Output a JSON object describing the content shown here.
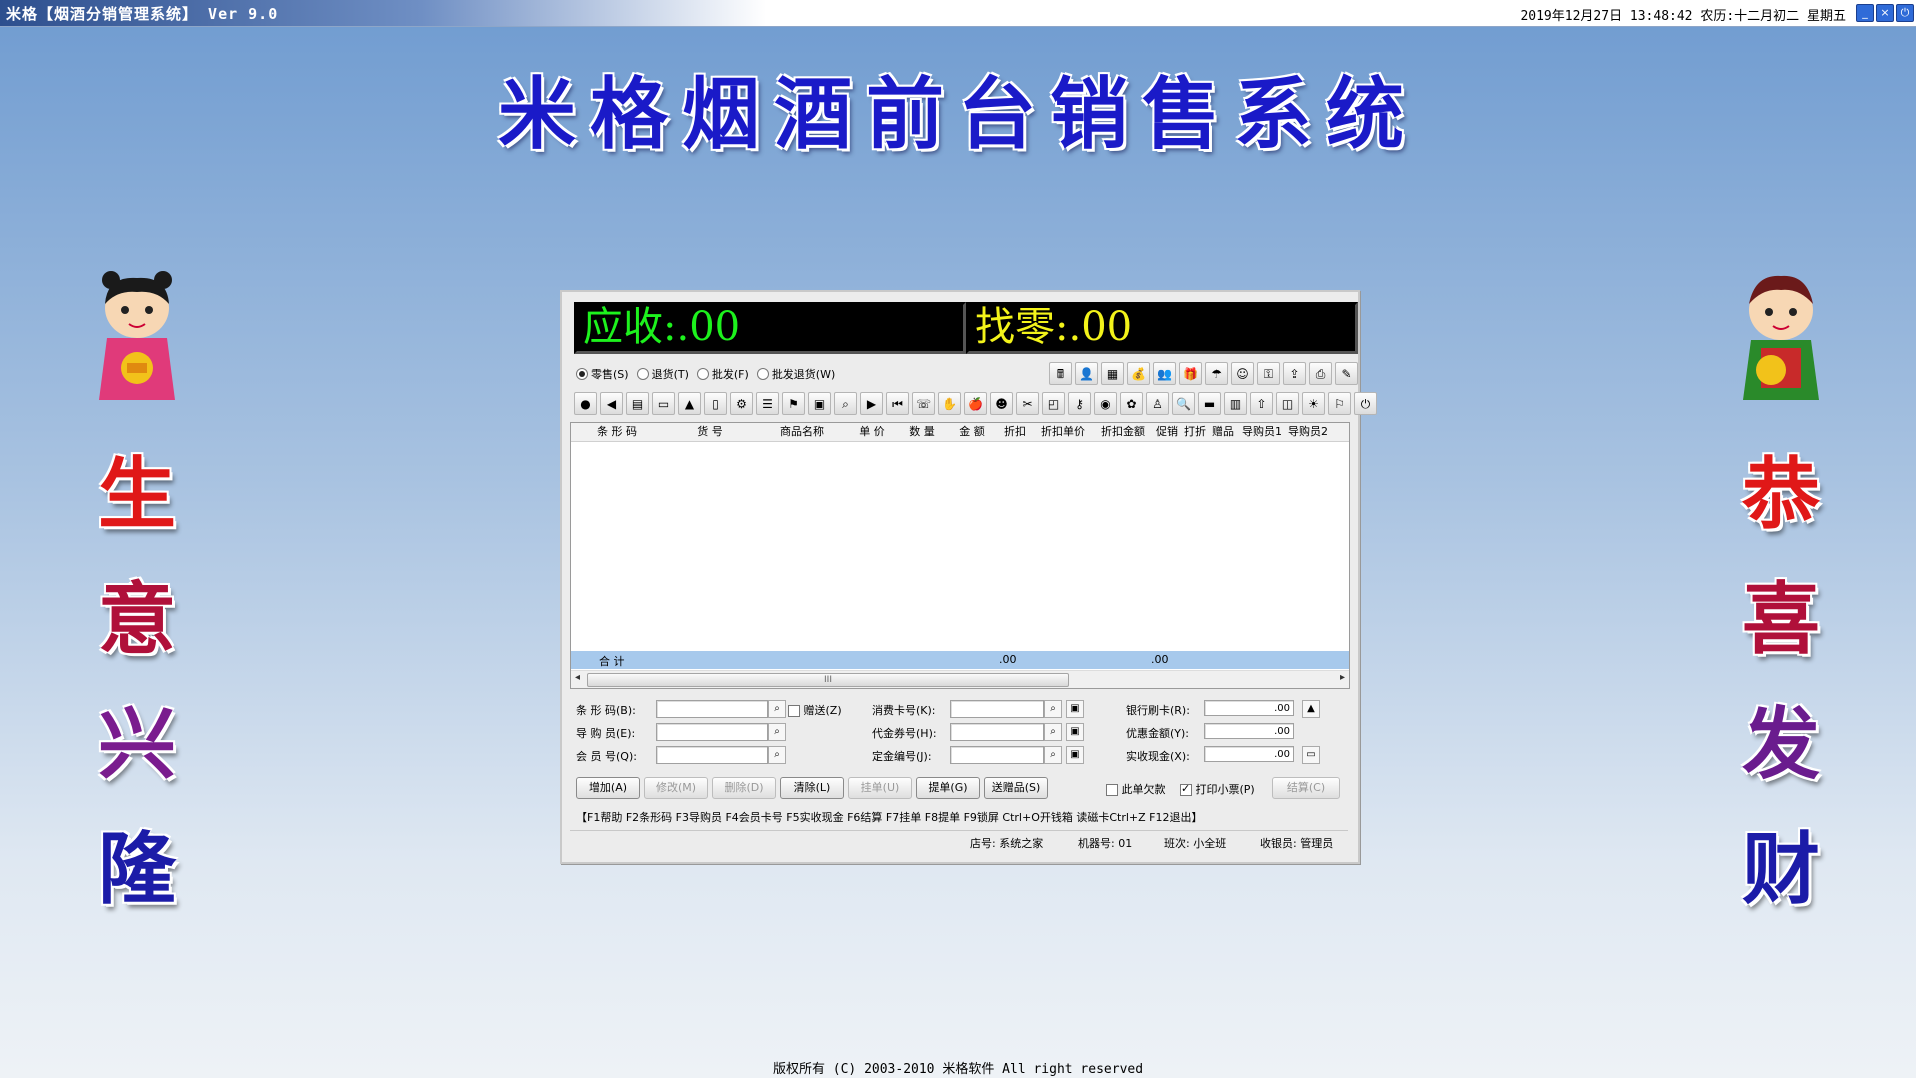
{
  "window": {
    "title": "米格【烟酒分销管理系统】 Ver 9.0",
    "datetime": "2019年12月27日 13:48:42 农历:十二月初二 星期五"
  },
  "banner": {
    "title": "米格烟酒前台销售系统"
  },
  "left_slogan": [
    "生",
    "意",
    "兴",
    "隆"
  ],
  "right_slogan": [
    "恭",
    "喜",
    "发",
    "财"
  ],
  "display": {
    "receivable_label": "应收:",
    "receivable_value": ".00",
    "change_label": "找零:",
    "change_value": ".00"
  },
  "modes": [
    {
      "label": "零售(S)",
      "selected": true
    },
    {
      "label": "退货(T)",
      "selected": false
    },
    {
      "label": "批发(F)",
      "selected": false
    },
    {
      "label": "批发退货(W)",
      "selected": false
    }
  ],
  "toolbar_top_icons": [
    "register-icon",
    "cashier-icon",
    "calendar-icon",
    "money-bag-icon",
    "users-icon",
    "gift-icon",
    "umbrella-icon",
    "people-icon",
    "key-icon",
    "upload-icon",
    "printer-icon",
    "pen-icon"
  ],
  "toolbar_icons": [
    "coin-icon",
    "back-icon",
    "doc-icon",
    "folder-icon",
    "up-icon",
    "page-icon",
    "gear-icon",
    "list-icon",
    "runner-icon",
    "stamp-icon",
    "search-doc-icon",
    "play-icon",
    "rewind-icon",
    "phone-icon",
    "hand-icon",
    "apple-icon",
    "user-gift-icon",
    "scissors-icon",
    "frame-icon",
    "key2-icon",
    "coins-icon",
    "gift2-icon",
    "person-icon",
    "find-icon",
    "card-icon",
    "box-icon",
    "arrow-up-icon",
    "jar-icon",
    "sun-icon",
    "flag-icon",
    "exit-icon"
  ],
  "grid": {
    "columns": [
      "条 形 码",
      "货  号",
      "商品名称",
      "单 价",
      "数 量",
      "金 额",
      "折扣",
      "折扣单价",
      "折扣金额",
      "促销",
      "打折",
      "赠品",
      "导购员1",
      "导购员2"
    ],
    "total_label": "合  计",
    "total_amount": ".00",
    "total_discount_amount": ".00",
    "scroll_thumb": "III"
  },
  "form": {
    "barcode_label": "条 形 码(B):",
    "gift_label": "赠送(Z)",
    "guide_label": "导 购 员(E):",
    "member_label": "会 员 号(Q):",
    "consume_card_label": "消费卡号(K):",
    "voucher_label": "代金券号(H):",
    "deposit_label": "定金编号(J):",
    "bank_card_label": "银行刷卡(R):",
    "bank_card_value": ".00",
    "discount_amount_label": "优惠金额(Y):",
    "discount_amount_value": ".00",
    "cash_label": "实收现金(X):",
    "cash_value": ".00"
  },
  "buttons": {
    "add": "增加(A)",
    "edit": "修改(M)",
    "delete": "删除(D)",
    "clear": "清除(L)",
    "hang": "挂单(U)",
    "pickup": "提单(G)",
    "gift_items": "送赠品(S)",
    "owe_label": "此单欠款",
    "print_label": "打印小票(P)",
    "settle": "结算(C)"
  },
  "hotkeys": "【F1帮助 F2条形码 F3导购员 F4会员卡号 F5实收现金 F6结算 F7挂单 F8提单 F9锁屏 Ctrl+O开钱箱 读磁卡Ctrl+Z F12退出】",
  "status": {
    "store": "店号: 系统之家",
    "machine": "机器号: 01",
    "shift": "班次: 小全班",
    "cashier": "收银员: 管理员"
  },
  "copyright": "版权所有 (C) 2003-2010 米格软件 All right reserved",
  "colors": {
    "title_blue": "#1a1ac8",
    "left_slogan": [
      "#e01818",
      "#b0103a",
      "#7a1c8e",
      "#1c1ca8"
    ],
    "right_slogan": [
      "#e01818",
      "#b0103a",
      "#6a1c8e",
      "#1c1ca8"
    ],
    "lcd_receivable": "#1df21d",
    "lcd_change": "#f3f31a"
  }
}
